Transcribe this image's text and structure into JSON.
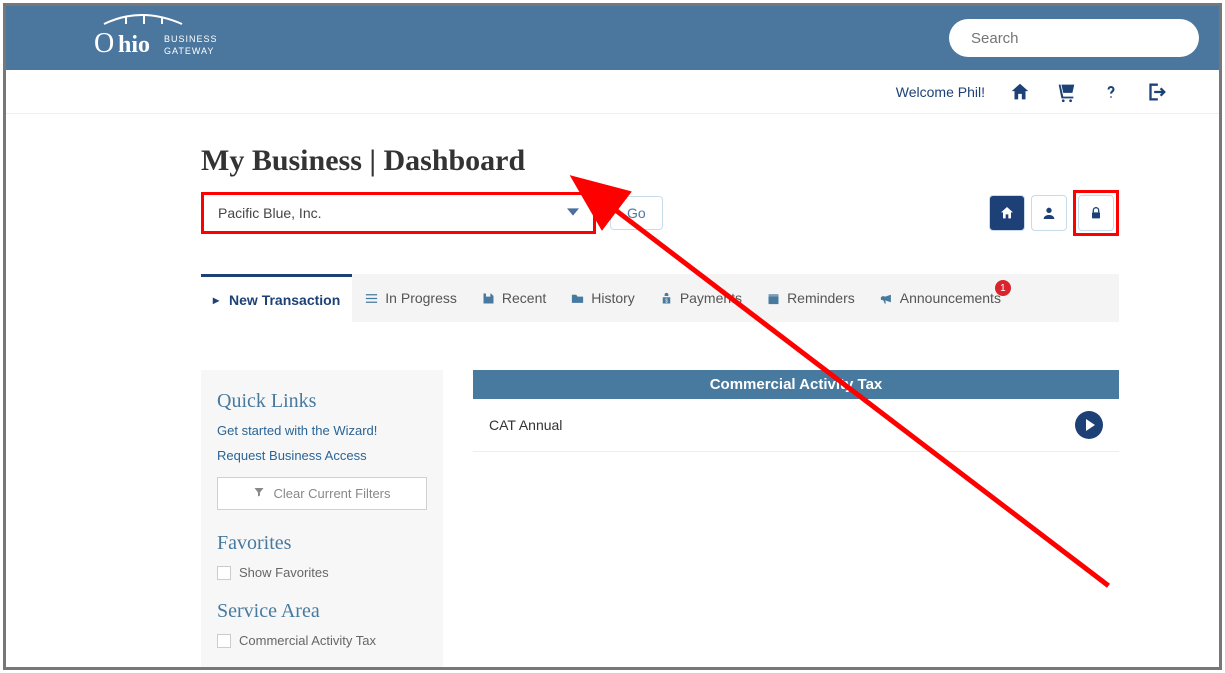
{
  "header": {
    "logo_main": "Ohio",
    "logo_sub_top": "BUSINESS",
    "logo_sub_bottom": "GATEWAY",
    "search_placeholder": "Search"
  },
  "userbar": {
    "welcome": "Welcome Phil!"
  },
  "page": {
    "title": "My Business | Dashboard",
    "business_selected": "Pacific Blue, Inc.",
    "go_label": "Go"
  },
  "tabs": [
    {
      "label": "New Transaction",
      "active": true
    },
    {
      "label": "In Progress"
    },
    {
      "label": "Recent"
    },
    {
      "label": "History"
    },
    {
      "label": "Payments"
    },
    {
      "label": "Reminders"
    },
    {
      "label": "Announcements",
      "badge": "1"
    }
  ],
  "sidebar": {
    "quick_links_title": "Quick Links",
    "wizard_link": "Get started with the Wizard!",
    "access_link": "Request Business Access",
    "clear_filters": "Clear Current Filters",
    "favorites_title": "Favorites",
    "show_favorites": "Show Favorites",
    "service_area_title": "Service Area",
    "service_area_item": "Commercial Activity Tax"
  },
  "main": {
    "section_header": "Commercial Activity Tax",
    "row_label": "CAT Annual"
  }
}
